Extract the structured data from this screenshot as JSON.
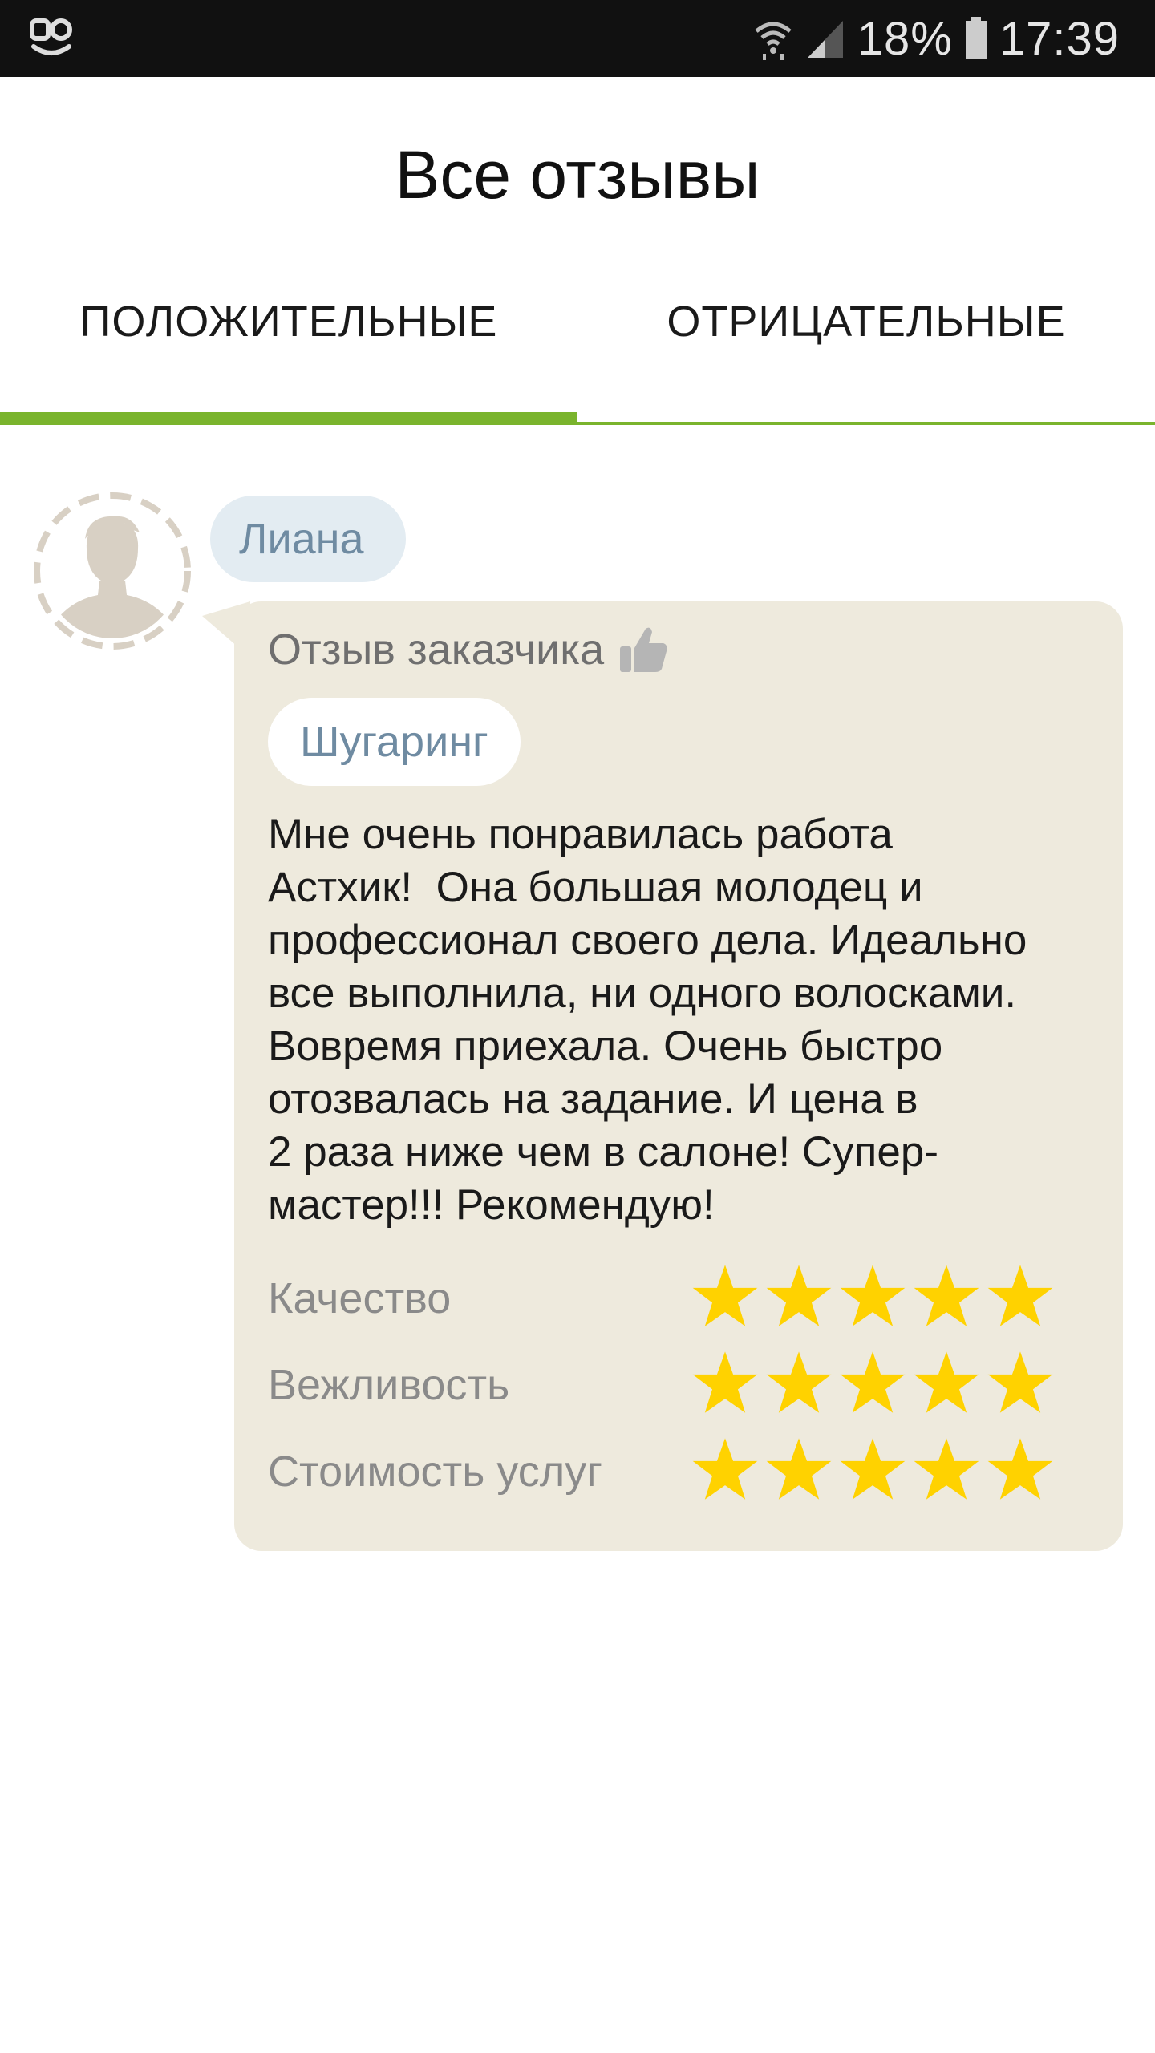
{
  "status_bar": {
    "logo_icon": "app-logo-icon",
    "battery": "18%",
    "time": "17:39"
  },
  "header": {
    "title": "Все отзывы"
  },
  "tabs": [
    {
      "label": "ПОЛОЖИТЕЛЬНЫЕ",
      "active": true
    },
    {
      "label": "ОТРИЦАТЕЛЬНЫЕ",
      "active": false
    }
  ],
  "accent_color": "#7ab42d",
  "star_color": "#ffd200",
  "review": {
    "author": "Лиана",
    "kind": "Отзыв заказчика",
    "kind_icon": "thumbs-up-icon",
    "service": "Шугаринг",
    "text_lines": [
      "Мне очень понравилась работа",
      "Астхик!  Она большая молодец и",
      "профессионал своего дела. Идеально",
      "все выполнила, ни одного волосками.",
      "Вовремя приехала. Очень быстро",
      "отозвалась на задание. И цена в",
      "2 раза ниже чем в салоне! Супер-",
      "мастер!!! Рекомендую!"
    ],
    "ratings": [
      {
        "label": "Качество",
        "stars": 5,
        "max": 5
      },
      {
        "label": "Вежливость",
        "stars": 5,
        "max": 5
      },
      {
        "label": "Стоимость услуг",
        "stars": 5,
        "max": 5
      }
    ]
  }
}
